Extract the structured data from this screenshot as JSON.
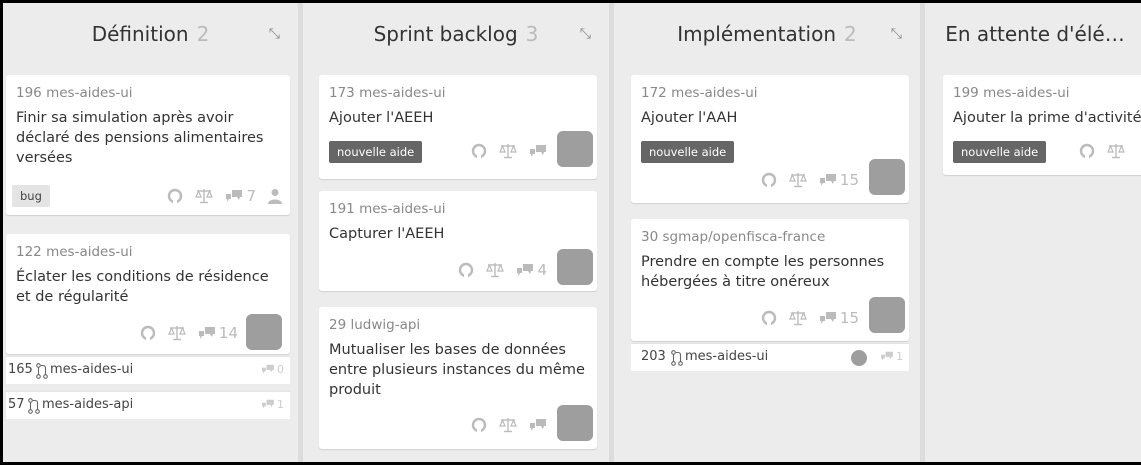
{
  "columns": [
    {
      "title": "Définition",
      "count": "2"
    },
    {
      "title": "Sprint backlog",
      "count": "3"
    },
    {
      "title": "Implémentation",
      "count": "2"
    },
    {
      "title": "En attente d'élé…",
      "count": ""
    }
  ],
  "cards": {
    "c196": {
      "number": "196",
      "repo": "mes-aides-ui",
      "title": "Finir sa simulation après avoir déclaré des pensions alimentaires versées",
      "label": "bug",
      "comments": "7"
    },
    "c122": {
      "number": "122",
      "repo": "mes-aides-ui",
      "title": "Éclater les conditions de résidence et de régularité",
      "comments": "14"
    },
    "c173": {
      "number": "173",
      "repo": "mes-aides-ui",
      "title": "Ajouter l'AEEH",
      "label": "nouvelle aide"
    },
    "c191": {
      "number": "191",
      "repo": "mes-aides-ui",
      "title": "Capturer l'AEEH",
      "comments": "4"
    },
    "c29": {
      "number": "29",
      "repo": "ludwig-api",
      "title": "Mutualiser les bases de données entre plusieurs instances du même produit"
    },
    "c172": {
      "number": "172",
      "repo": "mes-aides-ui",
      "title": "Ajouter l'AAH",
      "label": "nouvelle aide",
      "comments": "15"
    },
    "c30": {
      "number": "30",
      "repo": "sgmap/openfisca-france",
      "title": "Prendre en compte les personnes hébergées à titre onéreux",
      "comments": "15"
    },
    "c199": {
      "number": "199",
      "repo": "mes-aides-ui",
      "title": "Ajouter la prime d'activité",
      "label": "nouvelle aide"
    }
  },
  "pulls": {
    "p165": {
      "number": "165",
      "repo": "mes-aides-ui",
      "comments": "0"
    },
    "p57": {
      "number": "57",
      "repo": "mes-aides-api",
      "comments": "1"
    },
    "p203": {
      "number": "203",
      "repo": "mes-aides-ui",
      "comments": "1"
    }
  },
  "icons": {
    "github": "github-icon",
    "scale": "balance-scale-icon",
    "comments": "comments-icon",
    "user": "user-icon",
    "pull": "pull-request-icon",
    "collapse": "compress-icon"
  }
}
